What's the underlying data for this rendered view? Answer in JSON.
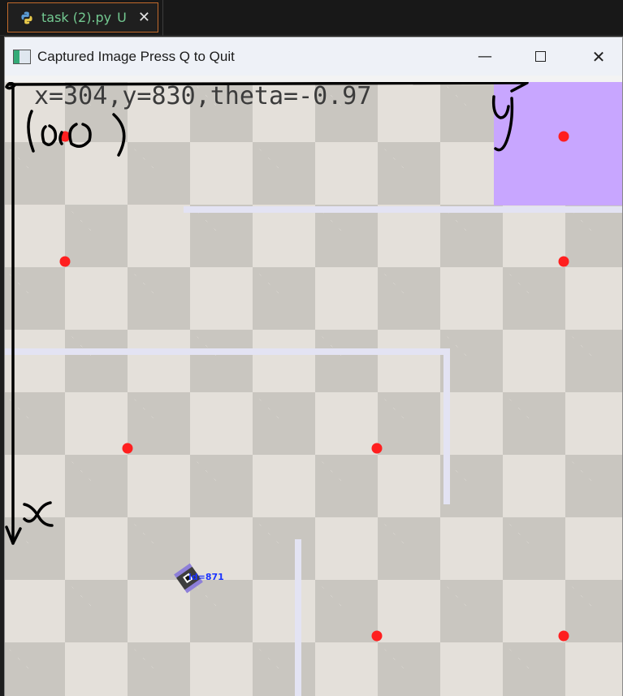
{
  "editor": {
    "tab_name": "task (2).py",
    "tab_badge": "U",
    "tab_close": "✕",
    "accent_color": "#73c991"
  },
  "window": {
    "title": "Captured Image Press Q to Quit",
    "min_glyph": "—",
    "close_glyph": "✕"
  },
  "arena": {
    "readout": "x=304,y=830,theta=-0.97",
    "robot_label": "id=871",
    "colors": {
      "target_zone": "#c8a6ff",
      "waypoint": "#ff1f1f",
      "wall": "#e3e3f3",
      "annotation_ink": "#000000"
    }
  },
  "annotations": {
    "origin_label": "(0,0)",
    "x_axis_label": "x",
    "y_axis_label": "y"
  }
}
